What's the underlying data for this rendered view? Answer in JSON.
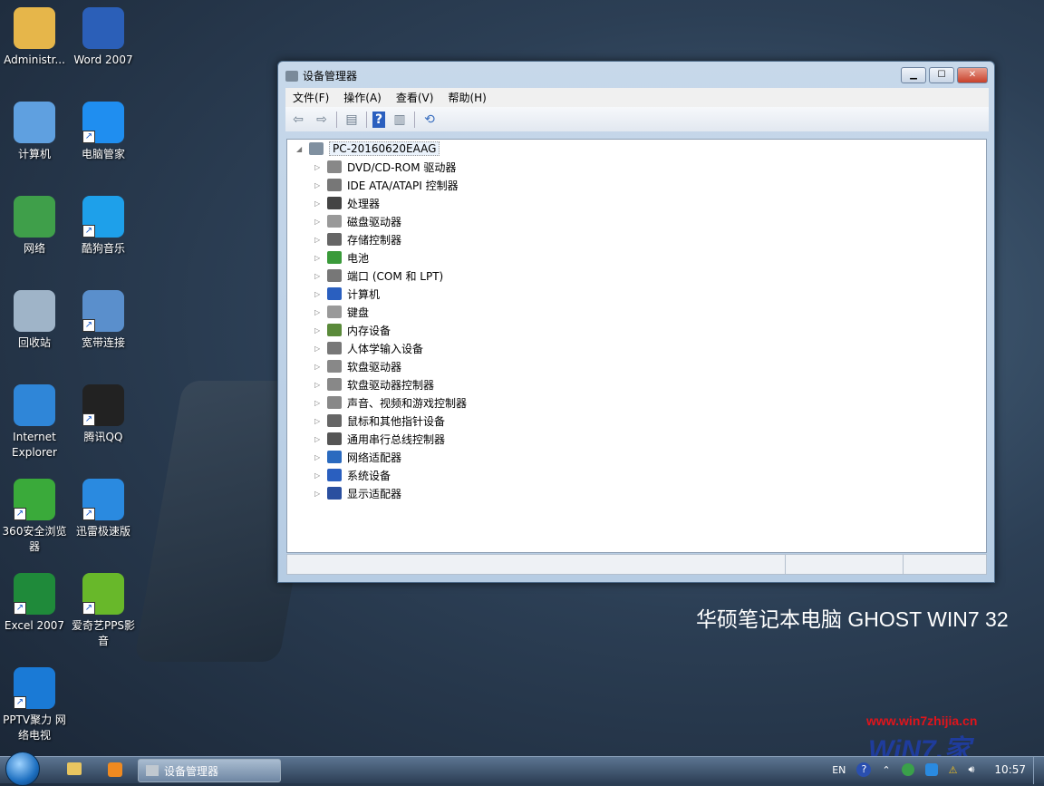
{
  "desktop": {
    "icons": [
      {
        "label": "Administr...",
        "icon": "user-folder-icon",
        "color": "#e6b64a"
      },
      {
        "label": "Word 2007",
        "icon": "word-icon",
        "color": "#2b5fb8"
      },
      {
        "label": "计算机",
        "icon": "computer-icon",
        "color": "#5fa0e0"
      },
      {
        "label": "电脑管家",
        "icon": "pc-manager-icon",
        "color": "#1f8ef0"
      },
      {
        "label": "网络",
        "icon": "network-icon",
        "color": "#3f9f4a"
      },
      {
        "label": "酷狗音乐",
        "icon": "kugou-icon",
        "color": "#1ea0ea"
      },
      {
        "label": "回收站",
        "icon": "recycle-bin-icon",
        "color": "#9fb4c8"
      },
      {
        "label": "宽带连接",
        "icon": "broadband-icon",
        "color": "#5a8fcc"
      },
      {
        "label": "Internet Explorer",
        "icon": "ie-icon",
        "color": "#2f86d8"
      },
      {
        "label": "腾讯QQ",
        "icon": "qq-icon",
        "color": "#222222"
      },
      {
        "label": "360安全浏览器",
        "icon": "360-browser-icon",
        "color": "#3aaa3a"
      },
      {
        "label": "迅雷极速版",
        "icon": "xunlei-icon",
        "color": "#2a8ae0"
      },
      {
        "label": "Excel 2007",
        "icon": "excel-icon",
        "color": "#1f8a3a"
      },
      {
        "label": "爱奇艺PPS影音",
        "icon": "iqiyi-icon",
        "color": "#68b82a"
      },
      {
        "label": "PPTV聚力 网络电视",
        "icon": "pptv-icon",
        "color": "#1a7ad6"
      }
    ],
    "brand_text": "华硕笔记本电脑  GHOST WIN7 32",
    "watermark_url": "www.win7zhijia.cn",
    "watermark_logo": "WiN7.家"
  },
  "window": {
    "title": "设备管理器",
    "controls": {
      "minimize": "▁",
      "maximize": "☐",
      "close": "✕"
    },
    "menu": [
      "文件(F)",
      "操作(A)",
      "查看(V)",
      "帮助(H)"
    ],
    "toolbar": {
      "back": "⇦",
      "forward": "⇨",
      "help": "?"
    },
    "tree": {
      "root": "PC-20160620EAAG",
      "items": [
        "DVD/CD-ROM 驱动器",
        "IDE ATA/ATAPI 控制器",
        "处理器",
        "磁盘驱动器",
        "存储控制器",
        "电池",
        "端口 (COM 和 LPT)",
        "计算机",
        "键盘",
        "内存设备",
        "人体学输入设备",
        "软盘驱动器",
        "软盘驱动器控制器",
        "声音、视频和游戏控制器",
        "鼠标和其他指针设备",
        "通用串行总线控制器",
        "网络适配器",
        "系统设备",
        "显示适配器"
      ]
    }
  },
  "taskbar": {
    "active_task": "设备管理器",
    "lang": "EN",
    "clock": "10:57"
  }
}
